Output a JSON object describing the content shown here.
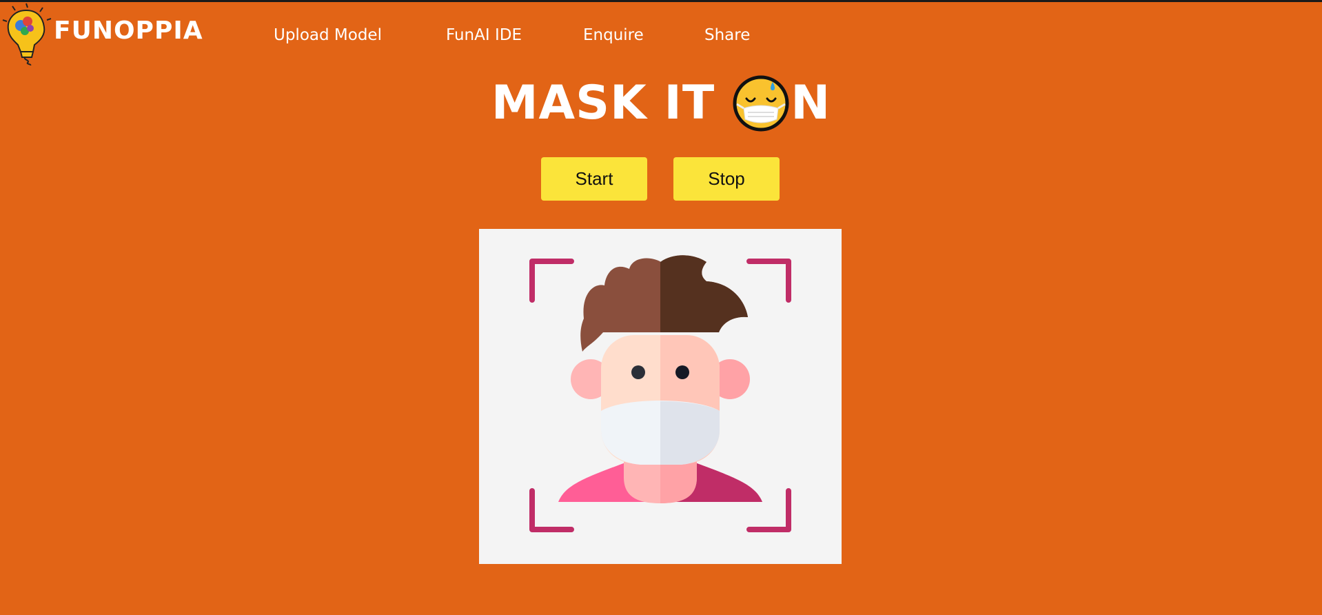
{
  "brand": {
    "name": "FUNOPPIA"
  },
  "nav": {
    "items": [
      {
        "label": "Upload Model"
      },
      {
        "label": "FunAI IDE"
      },
      {
        "label": "Enquire"
      },
      {
        "label": "Share"
      }
    ]
  },
  "hero": {
    "title_left": "MASK IT",
    "title_right": "N",
    "title_icon": "masked-face-emoji-icon"
  },
  "controls": {
    "start_label": "Start",
    "stop_label": "Stop"
  },
  "preview": {
    "image_icon": "masked-person-face-scan-icon"
  },
  "colors": {
    "background": "#E26416",
    "button": "#FBE43A",
    "frame_bg": "#F4F4F4",
    "scan_corners": "#C02D67",
    "text": "#FFFFFF"
  }
}
